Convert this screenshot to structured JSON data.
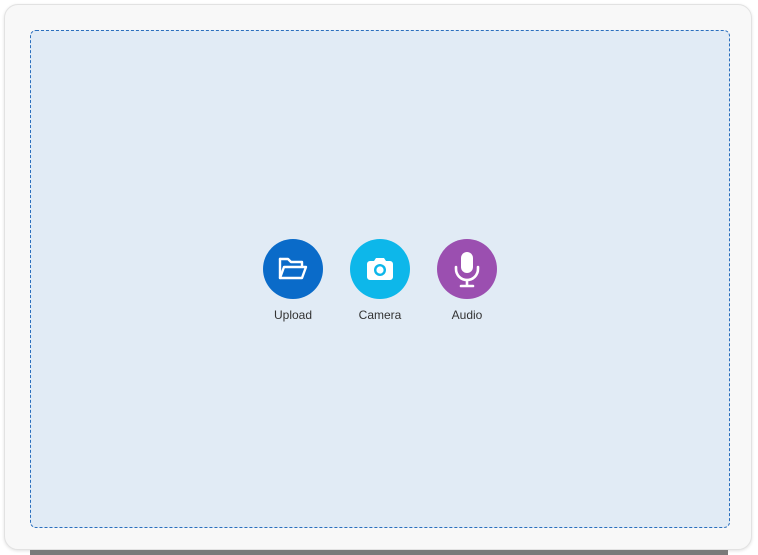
{
  "dropzone": {
    "actions": [
      {
        "label": "Upload",
        "icon": "folder-open-icon",
        "color": "#0a6bc9"
      },
      {
        "label": "Camera",
        "icon": "camera-icon",
        "color": "#0db7ea"
      },
      {
        "label": "Audio",
        "icon": "microphone-icon",
        "color": "#9b4fb0"
      }
    ],
    "background": "#e1ebf5",
    "border_color": "#2a6fbe"
  }
}
